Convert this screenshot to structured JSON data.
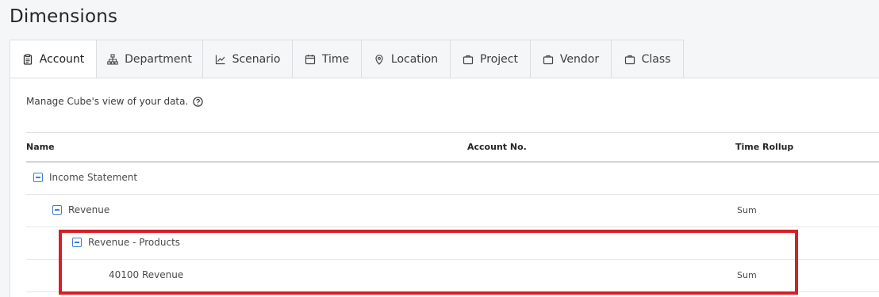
{
  "page": {
    "title": "Dimensions"
  },
  "tabs": [
    {
      "label": "Account",
      "icon": "clipboard-icon",
      "active": true
    },
    {
      "label": "Department",
      "icon": "org-chart-icon",
      "active": false
    },
    {
      "label": "Scenario",
      "icon": "line-chart-icon",
      "active": false
    },
    {
      "label": "Time",
      "icon": "calendar-icon",
      "active": false
    },
    {
      "label": "Location",
      "icon": "map-pin-icon",
      "active": false
    },
    {
      "label": "Project",
      "icon": "briefcase-icon",
      "active": false
    },
    {
      "label": "Vendor",
      "icon": "briefcase-icon",
      "active": false
    },
    {
      "label": "Class",
      "icon": "briefcase-icon",
      "active": false
    }
  ],
  "panel": {
    "intro": "Manage Cube's view of your data.",
    "columns": {
      "name": "Name",
      "account_no": "Account No.",
      "time_rollup": "Time Rollup"
    },
    "rows": [
      {
        "name": "Income Statement",
        "account_no": "",
        "time_rollup": "",
        "collapsible": true
      },
      {
        "name": "Revenue",
        "account_no": "",
        "time_rollup": "Sum",
        "collapsible": true
      },
      {
        "name": "Revenue - Products",
        "account_no": "",
        "time_rollup": "",
        "collapsible": true
      },
      {
        "name": "40100 Revenue",
        "account_no": "",
        "time_rollup": "Sum",
        "collapsible": false
      }
    ]
  },
  "colors": {
    "accent": "#3b7ed8",
    "highlight": "#d61f26",
    "background": "#f5f6f7",
    "panel": "#ffffff"
  }
}
